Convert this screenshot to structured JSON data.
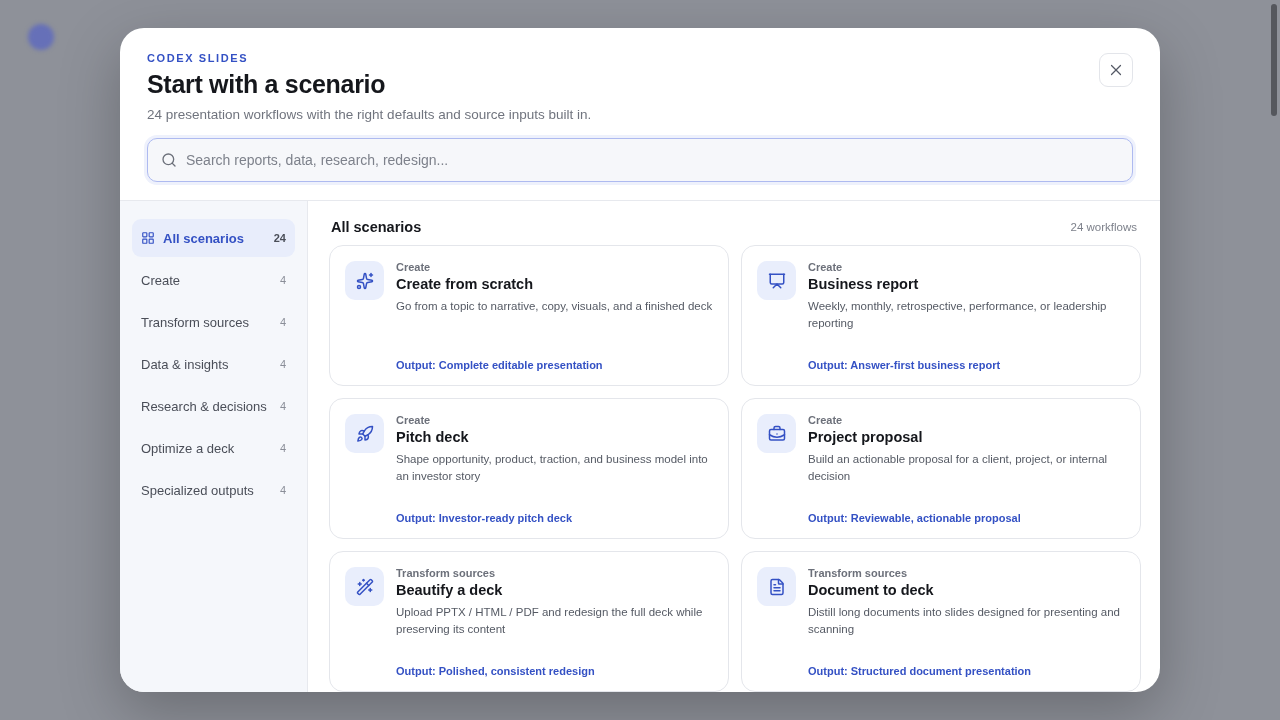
{
  "modal": {
    "eyebrow": "CODEX SLIDES",
    "title": "Start with a scenario",
    "subtitle": "24 presentation workflows with the right defaults and source inputs built in.",
    "search": {
      "placeholder": "Search reports, data, research, redesign..."
    }
  },
  "sidebar": {
    "items": [
      {
        "label": "All scenarios",
        "count": "24",
        "selected": true
      },
      {
        "label": "Create",
        "count": "4",
        "selected": false
      },
      {
        "label": "Transform sources",
        "count": "4",
        "selected": false
      },
      {
        "label": "Data & insights",
        "count": "4",
        "selected": false
      },
      {
        "label": "Research & decisions",
        "count": "4",
        "selected": false
      },
      {
        "label": "Optimize a deck",
        "count": "4",
        "selected": false
      },
      {
        "label": "Specialized outputs",
        "count": "4",
        "selected": false
      }
    ]
  },
  "content": {
    "heading": "All scenarios",
    "count": "24 workflows",
    "cards": [
      {
        "category": "Create",
        "title": "Create from scratch",
        "description": "Go from a topic to narrative, copy, visuals, and a finished deck",
        "output": "Output: Complete editable presentation"
      },
      {
        "category": "Create",
        "title": "Business report",
        "description": "Weekly, monthly, retrospective, performance, or leadership reporting",
        "output": "Output: Answer-first business report"
      },
      {
        "category": "Create",
        "title": "Pitch deck",
        "description": "Shape opportunity, product, traction, and business model into an investor story",
        "output": "Output: Investor-ready pitch deck"
      },
      {
        "category": "Create",
        "title": "Project proposal",
        "description": "Build an actionable proposal for a client, project, or internal decision",
        "output": "Output: Reviewable, actionable proposal"
      },
      {
        "category": "Transform sources",
        "title": "Beautify a deck",
        "description": "Upload PPTX / HTML / PDF and redesign the full deck while preserving its content",
        "output": "Output: Polished, consistent redesign"
      },
      {
        "category": "Transform sources",
        "title": "Document to deck",
        "description": "Distill long documents into slides designed for presenting and scanning",
        "output": "Output: Structured document presentation"
      }
    ]
  }
}
